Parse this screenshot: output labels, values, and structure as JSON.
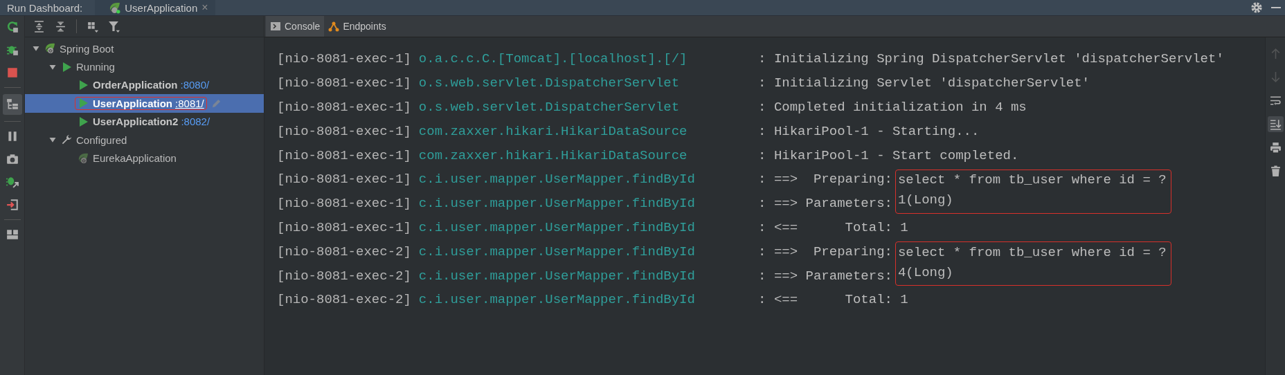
{
  "window": {
    "title": "Run Dashboard:",
    "tab": {
      "label": "UserApplication",
      "close": "×"
    }
  },
  "left_toolbar": [
    {
      "kind": "rerun",
      "on": false
    },
    {
      "kind": "debug",
      "on": false
    },
    {
      "kind": "stop",
      "on": false
    },
    {
      "kind": "separator"
    },
    {
      "kind": "tree-layout",
      "on": true
    },
    {
      "kind": "separator"
    },
    {
      "kind": "pause",
      "on": false
    },
    {
      "kind": "camera",
      "on": false
    },
    {
      "kind": "debug-attach",
      "on": false
    },
    {
      "kind": "exit",
      "on": false
    },
    {
      "kind": "separator"
    },
    {
      "kind": "layout",
      "on": false
    }
  ],
  "tree_toolbar": [
    {
      "kind": "expand-all"
    },
    {
      "kind": "collapse-all"
    },
    {
      "kind": "separator"
    },
    {
      "kind": "group"
    },
    {
      "kind": "filter"
    }
  ],
  "tree": [
    {
      "label": "Spring Boot",
      "kind": "boot",
      "expanded": true,
      "selected": false,
      "children": [
        {
          "label": "Running",
          "kind": "running",
          "expanded": true,
          "selected": false,
          "children": [
            {
              "label": "OrderApplication",
              "port": ":8080/",
              "kind": "app",
              "selected": false,
              "annotated": false
            },
            {
              "label": "UserApplication",
              "port": ":8081/",
              "kind": "app",
              "selected": true,
              "annotated": true
            },
            {
              "label": "UserApplication2",
              "port": ":8082/",
              "kind": "app",
              "selected": false,
              "annotated": false
            }
          ]
        },
        {
          "label": "Configured",
          "kind": "configured",
          "expanded": true,
          "selected": false,
          "children": [
            {
              "label": "EurekaApplication",
              "kind": "idle-app",
              "selected": false,
              "annotated": false
            }
          ]
        }
      ]
    }
  ],
  "console_tabs": [
    {
      "label": "Console",
      "kind": "console",
      "selected": true
    },
    {
      "label": "Endpoints",
      "kind": "endpoints",
      "selected": false
    }
  ],
  "log": [
    {
      "thread": "[nio-8081-exec-1]",
      "logger": "o.a.c.c.C.[Tomcat].[localhost].[/]",
      "message": ": Initializing Spring DispatcherServlet 'dispatcherServlet'",
      "boxed": false
    },
    {
      "thread": "[nio-8081-exec-1]",
      "logger": "o.s.web.servlet.DispatcherServlet",
      "message": ": Initializing Servlet 'dispatcherServlet'",
      "boxed": false
    },
    {
      "thread": "[nio-8081-exec-1]",
      "logger": "o.s.web.servlet.DispatcherServlet",
      "message": ": Completed initialization in 4 ms",
      "boxed": false
    },
    {
      "thread": "[nio-8081-exec-1]",
      "logger": "com.zaxxer.hikari.HikariDataSource",
      "message": ": HikariPool-1 - Starting...",
      "boxed": false
    },
    {
      "thread": "[nio-8081-exec-1]",
      "logger": "com.zaxxer.hikari.HikariDataSource",
      "message": ": HikariPool-1 - Start completed.",
      "boxed": false
    },
    {
      "thread": "[nio-8081-exec-1]",
      "logger": "c.i.user.mapper.UserMapper.findById",
      "message": ": ==>  Preparing:",
      "value": "select * from tb_user where id = ?",
      "boxed": true
    },
    {
      "thread": "[nio-8081-exec-1]",
      "logger": "c.i.user.mapper.UserMapper.findById",
      "message": ": ==> Parameters:",
      "value": "1(Long)",
      "boxed": true
    },
    {
      "thread": "[nio-8081-exec-1]",
      "logger": "c.i.user.mapper.UserMapper.findById",
      "message": ": <==      Total: 1",
      "boxed": false
    },
    {
      "thread": "[nio-8081-exec-2]",
      "logger": "c.i.user.mapper.UserMapper.findById",
      "message": ": ==>  Preparing:",
      "value": "select * from tb_user where id = ?",
      "boxed": true
    },
    {
      "thread": "[nio-8081-exec-2]",
      "logger": "c.i.user.mapper.UserMapper.findById",
      "message": ": ==> Parameters:",
      "value": "4(Long)",
      "boxed": true
    },
    {
      "thread": "[nio-8081-exec-2]",
      "logger": "c.i.user.mapper.UserMapper.findById",
      "message": ": <==      Total: 1",
      "boxed": false
    }
  ],
  "right_toolbar": [
    {
      "kind": "up",
      "disabled": true,
      "on": false
    },
    {
      "kind": "down",
      "disabled": true,
      "on": false
    },
    {
      "kind": "wrap",
      "disabled": false,
      "on": false
    },
    {
      "kind": "scroll-end",
      "disabled": false,
      "on": true
    },
    {
      "kind": "print",
      "disabled": false,
      "on": false
    },
    {
      "kind": "clear",
      "disabled": false,
      "on": false
    }
  ]
}
